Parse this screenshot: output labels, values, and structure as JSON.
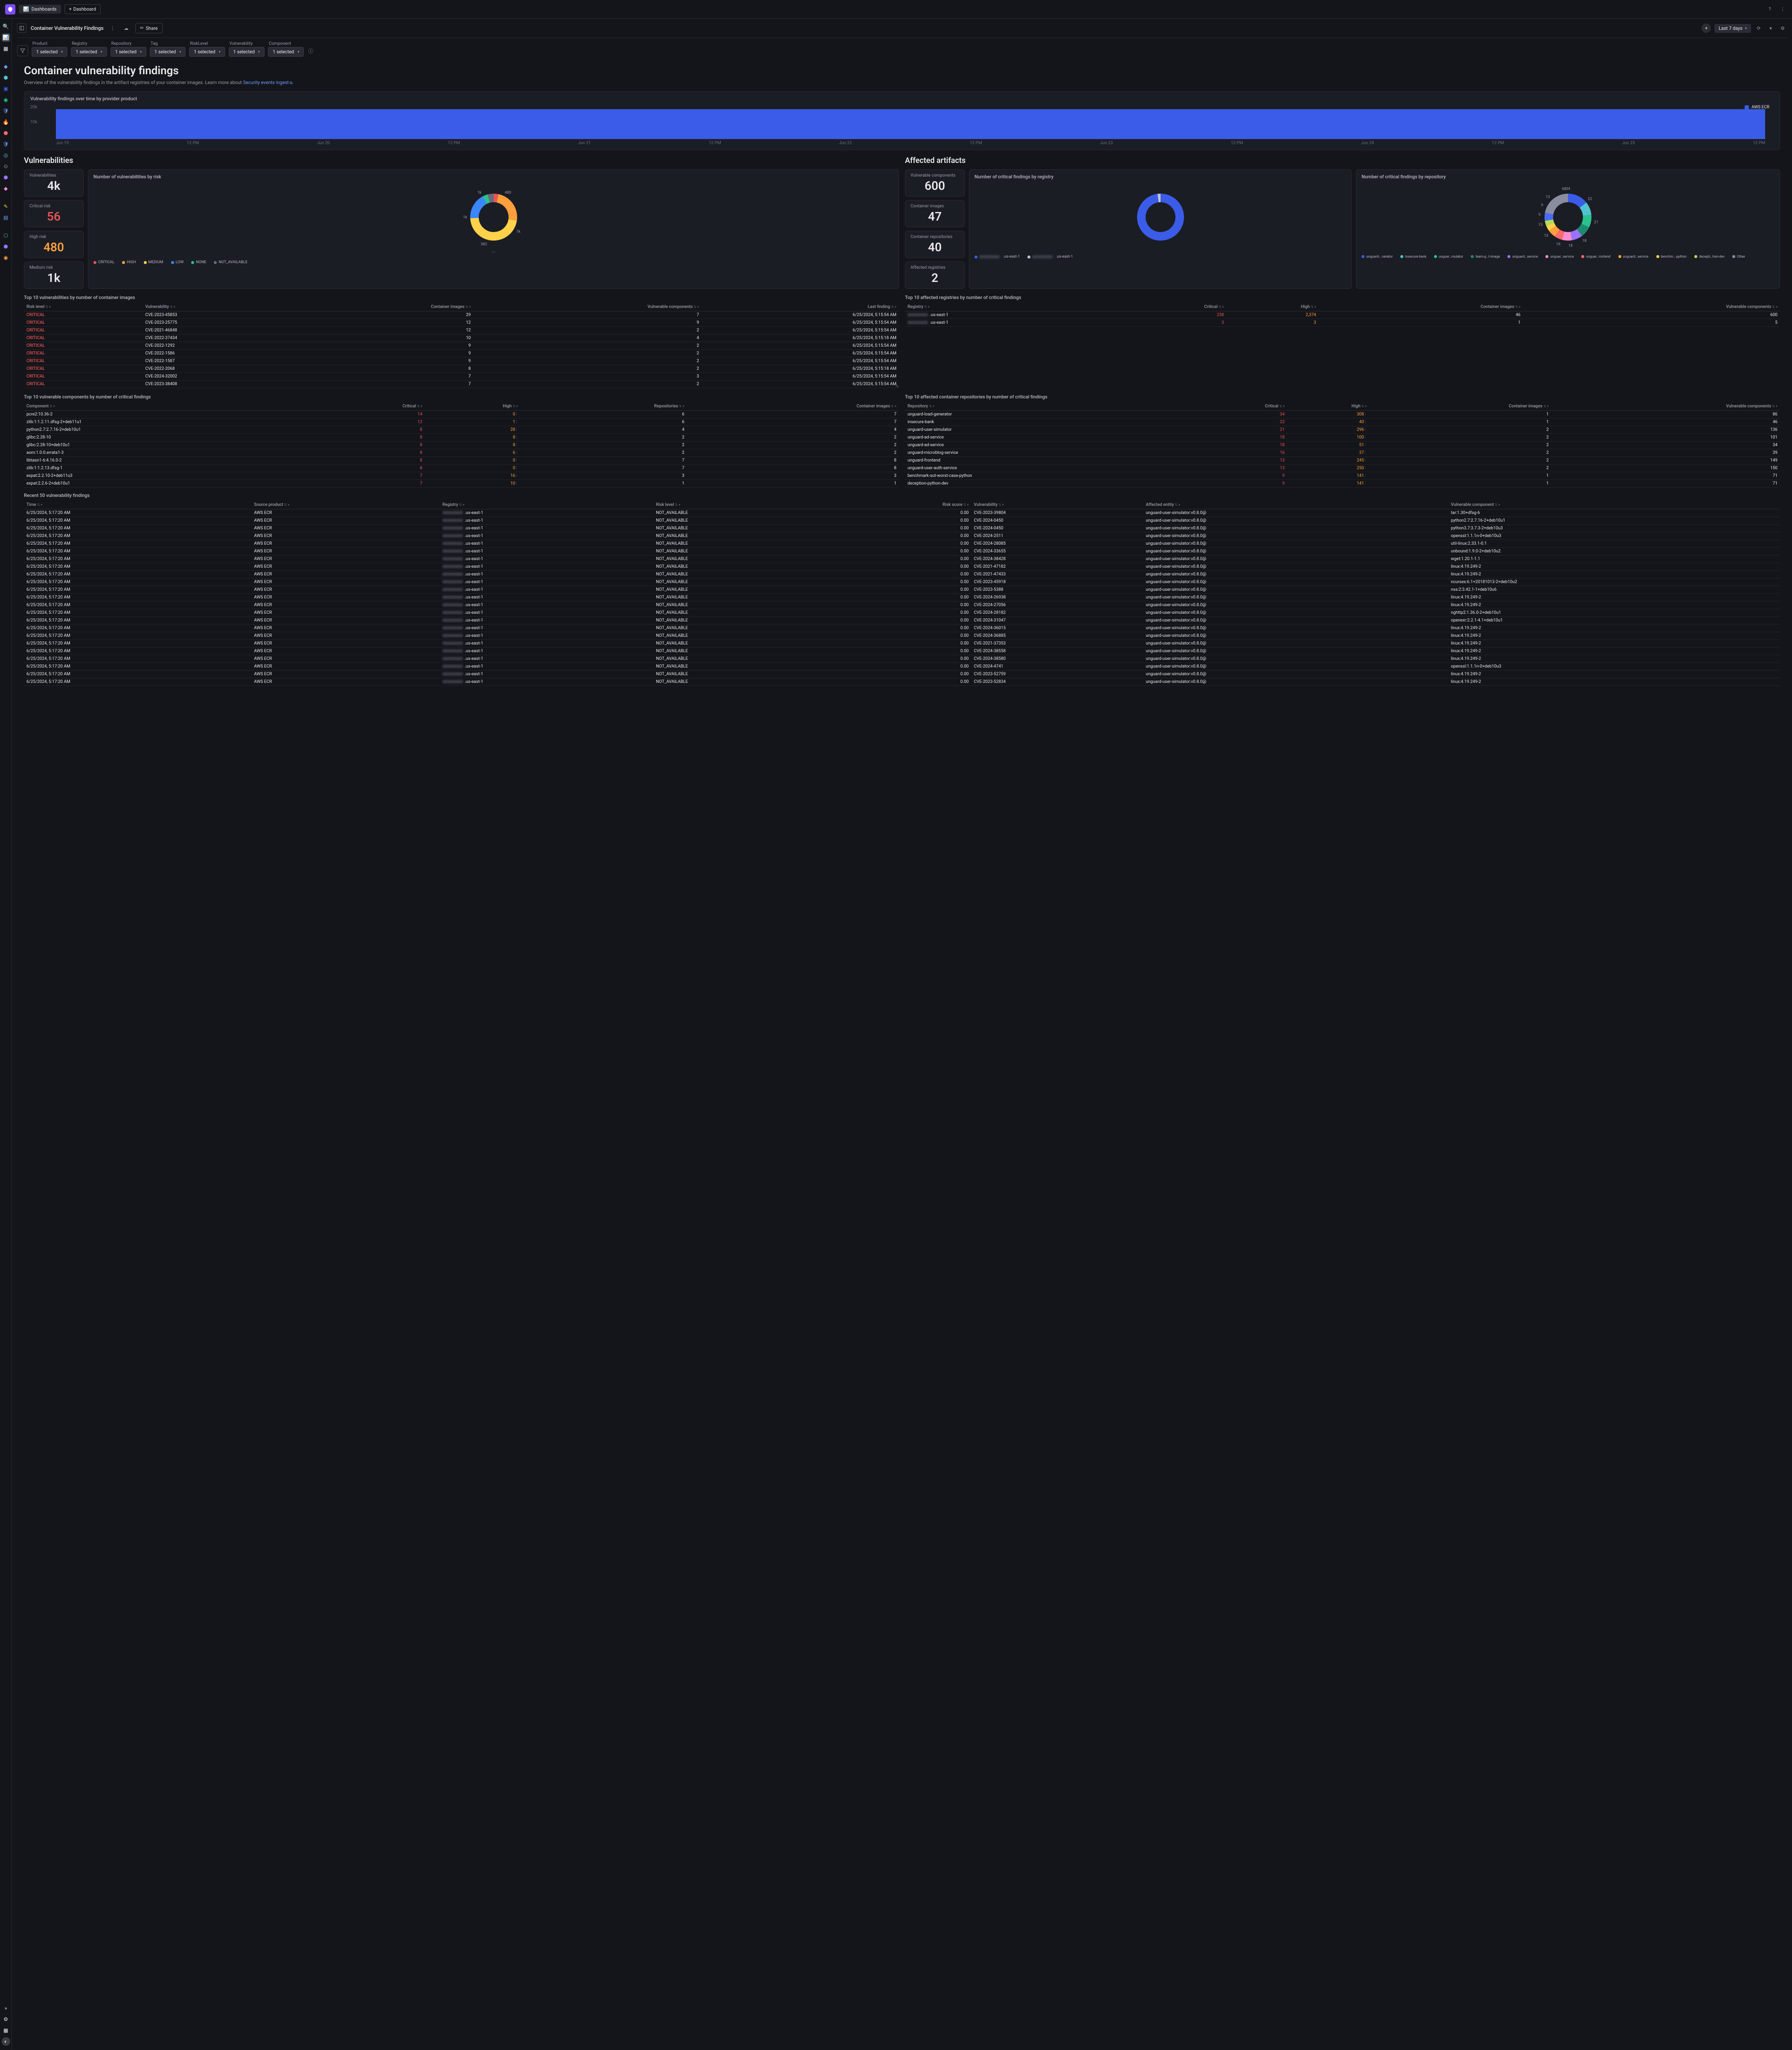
{
  "breadcrumb": {
    "dashboards": "Dashboards",
    "new_dashboard": "Dashboard"
  },
  "page": {
    "title": "Container Vulnerability Findings",
    "share": "Share",
    "timerange": "Last 7 days"
  },
  "filters": [
    {
      "label": "Product",
      "value": "1 selected"
    },
    {
      "label": "Registry",
      "value": "1 selected"
    },
    {
      "label": "Repository",
      "value": "1 selected"
    },
    {
      "label": "Tag",
      "value": "1 selected"
    },
    {
      "label": "RiskLevel",
      "value": "1 selected"
    },
    {
      "label": "Vulnerability",
      "value": "1 selected"
    },
    {
      "label": "Component",
      "value": "1 selected"
    }
  ],
  "heading": "Container vulnerability findings",
  "subtitle_prefix": "Overview of the vulnerability findings in the artifact registries of your container images. Learn more about ",
  "subtitle_link": "Security events ingest",
  "chart_time_title": "Vulnerability findings over time by provider product",
  "chart_time_legend": "AWS ECR",
  "chart_data": {
    "type": "bar",
    "title": "Vulnerability findings over time by provider product",
    "ylabel": "",
    "xlabel": "",
    "ylim": [
      0,
      20000
    ],
    "y_ticks": [
      "20k",
      "10k",
      ""
    ],
    "x_ticks": [
      "Jun 19",
      "12 PM",
      "Jun 20",
      "12 PM",
      "Jun 21",
      "12 PM",
      "Jun 22",
      "12 PM",
      "Jun 23",
      "12 PM",
      "Jun 24",
      "12 PM",
      "Jun 25",
      "12 PM"
    ],
    "series": [
      {
        "name": "AWS ECR",
        "color": "#3b5ce8",
        "values": [
          20000,
          20000,
          20000,
          20000,
          20000,
          20000,
          20000,
          20000,
          20000,
          20000,
          20000,
          20000,
          20000,
          20000
        ]
      }
    ]
  },
  "sections": {
    "vuln": "Vulnerabilities",
    "artifacts": "Affected artifacts"
  },
  "metrics_vuln": [
    {
      "label": "Vulnerabilities",
      "value": "4k"
    },
    {
      "label": "Critical risk",
      "value": "56",
      "cls": "red"
    },
    {
      "label": "High risk",
      "value": "480",
      "cls": "orange"
    },
    {
      "label": "Medium risk",
      "value": "1k"
    }
  ],
  "donut_risk": {
    "title": "Number of vulnerabilities by risk",
    "labels": [
      {
        "text": "480",
        "a": -60
      },
      {
        "text": "1k",
        "a": 30
      },
      {
        "text": "382",
        "a": 110
      },
      {
        "text": "1k",
        "a": 180
      },
      {
        "text": "1k",
        "a": 240
      }
    ],
    "segments": [
      {
        "c": "#e85454",
        "d": 16
      },
      {
        "c": "#ff9f3e",
        "d": 118
      },
      {
        "c": "#ffd24a",
        "d": 230
      },
      {
        "c": "#3a86ff",
        "d": 88
      },
      {
        "c": "#29c28e",
        "d": 18
      },
      {
        "c": "#6a6a78",
        "d": 20
      }
    ],
    "legend": [
      {
        "c": "#e85454",
        "t": "CRITICAL"
      },
      {
        "c": "#ff9f3e",
        "t": "HIGH"
      },
      {
        "c": "#ffd24a",
        "t": "MEDIUM"
      },
      {
        "c": "#3a86ff",
        "t": "LOW"
      },
      {
        "c": "#29c28e",
        "t": "NONE"
      },
      {
        "c": "#6a6a78",
        "t": "NOT_AVAILABLE"
      }
    ]
  },
  "metrics_art": [
    {
      "label": "Vulnerable components",
      "value": "600"
    },
    {
      "label": "Container images",
      "value": "47"
    },
    {
      "label": "Container repositories",
      "value": "40"
    },
    {
      "label": "Affected registries",
      "value": "2"
    }
  ],
  "donut_registry": {
    "title": "Number of critical findings by registry",
    "segments": [
      {
        "c": "#3b5ce8",
        "d": 480
      },
      {
        "c": "#c0c4d2",
        "d": 10
      }
    ],
    "legend": [
      {
        "c": "#3b5ce8",
        "t": ".us-east-1"
      },
      {
        "c": "#c0c4d2",
        "t": ".us-east-1"
      }
    ]
  },
  "donut_repo": {
    "title": "Number of critical findings by repository",
    "labels": [
      {
        "text": "34",
        "a": -90
      },
      {
        "text": "22",
        "a": -40
      },
      {
        "text": "21",
        "a": 10
      },
      {
        "text": "18",
        "a": 55
      },
      {
        "text": "18",
        "a": 85
      },
      {
        "text": "16",
        "a": 110
      },
      {
        "text": "13",
        "a": 140
      },
      {
        "text": "13",
        "a": 165
      },
      {
        "text": "9",
        "a": 185
      },
      {
        "text": "9",
        "a": 205
      },
      {
        "text": "13",
        "a": 225
      },
      {
        "text": "68",
        "a": 262
      }
    ],
    "segments": [
      {
        "c": "#3b5ce8",
        "d": 70
      },
      {
        "c": "#4fc4cf",
        "d": 45
      },
      {
        "c": "#29c28e",
        "d": 43
      },
      {
        "c": "#1b8d6e",
        "d": 37
      },
      {
        "c": "#9b72ff",
        "d": 37
      },
      {
        "c": "#ff8bd1",
        "d": 33
      },
      {
        "c": "#ff6b6b",
        "d": 27
      },
      {
        "c": "#ff9f3e",
        "d": 27
      },
      {
        "c": "#ffd24a",
        "d": 18
      },
      {
        "c": "#b5de54",
        "d": 18
      },
      {
        "c": "#4a6bff",
        "d": 27
      },
      {
        "c": "#8a8da0",
        "d": 108
      }
    ],
    "legend": [
      {
        "c": "#3b5ce8",
        "t": "unguard-…nerator"
      },
      {
        "c": "#4fc4cf",
        "t": "insecure-bank"
      },
      {
        "c": "#29c28e",
        "t": "unguar…mulator"
      },
      {
        "c": "#1b8d6e",
        "t": "team-g…t-image"
      },
      {
        "c": "#9b72ff",
        "t": "unguard…service"
      },
      {
        "c": "#ff8bd1",
        "t": "unguar…service"
      },
      {
        "c": "#ff6b6b",
        "t": "unguar…rontend"
      },
      {
        "c": "#ff9f3e",
        "t": "unguard…service"
      },
      {
        "c": "#ffd24a",
        "t": "benchm…-python"
      },
      {
        "c": "#b5de54",
        "t": "decepti…hon-dev"
      },
      {
        "c": "#8a8da0",
        "t": "Other"
      }
    ]
  },
  "table_top_vuln": {
    "title": "Top 10 vulnerabilities by number of container images",
    "cols": [
      "Risk level",
      "Vulnerability",
      "Container images",
      "Vulnerable components",
      "Last finding"
    ],
    "rows": [
      [
        "CRITICAL",
        "CVE-2023-45853",
        "29",
        "7",
        "6/25/2024, 5:15:54 AM"
      ],
      [
        "CRITICAL",
        "CVE-2023-25775",
        "12",
        "9",
        "6/25/2024, 5:15:54 AM"
      ],
      [
        "CRITICAL",
        "CVE-2021-46848",
        "12",
        "2",
        "6/25/2024, 5:15:54 AM"
      ],
      [
        "CRITICAL",
        "CVE-2022-37434",
        "10",
        "4",
        "6/25/2024, 5:15:18 AM"
      ],
      [
        "CRITICAL",
        "CVE-2022-1292",
        "9",
        "2",
        "6/25/2024, 5:15:54 AM"
      ],
      [
        "CRITICAL",
        "CVE-2022-1586",
        "9",
        "2",
        "6/25/2024, 5:15:54 AM"
      ],
      [
        "CRITICAL",
        "CVE-2022-1587",
        "9",
        "2",
        "6/25/2024, 5:15:54 AM"
      ],
      [
        "CRITICAL",
        "CVE-2022-2068",
        "8",
        "2",
        "6/25/2024, 5:15:18 AM"
      ],
      [
        "CRITICAL",
        "CVE-2024-32002",
        "7",
        "3",
        "6/25/2024, 5:15:54 AM"
      ],
      [
        "CRITICAL",
        "CVE-2023-38408",
        "7",
        "2",
        "6/25/2024, 5:15:54 AM"
      ]
    ]
  },
  "table_top_registries": {
    "title": "Top 10 affected registries by number of critical findings",
    "cols": [
      "Registry",
      "Critical",
      "High",
      "Container images",
      "Vulnerable components"
    ],
    "rows": [
      [
        ".us-east-1",
        "238",
        "2,374",
        "46",
        "600"
      ],
      [
        ".us-east-1",
        "3",
        "3",
        "1",
        "5"
      ]
    ]
  },
  "table_top_components": {
    "title": "Top 10 vulnerable components by number of critical findings",
    "cols": [
      "Component",
      "Critical",
      "High",
      "Repositories",
      "Container images"
    ],
    "rows": [
      [
        "pcre2:10.36-2",
        "14",
        "0",
        "6",
        "7"
      ],
      [
        "zlib:1:1.2.11.dfsg-2+deb11u1",
        "12",
        "1",
        "6",
        "7"
      ],
      [
        "python2.7:2.7.16-2+deb10u1",
        "8",
        "28",
        "4",
        "4"
      ],
      [
        "glibc:2.28-10",
        "8",
        "8",
        "2",
        "2"
      ],
      [
        "glibc:2.28-10+deb10u1",
        "8",
        "8",
        "2",
        "2"
      ],
      [
        "aom:1.0.0.errata1-3",
        "8",
        "6",
        "2",
        "2"
      ],
      [
        "libtasn1-6:4.16.0-2",
        "8",
        "0",
        "7",
        "8"
      ],
      [
        "zlib:1:1.2.13.dfsg-1",
        "8",
        "0",
        "7",
        "8"
      ],
      [
        "expat:2.2.10-2+deb11u3",
        "7",
        "16",
        "3",
        "3"
      ],
      [
        "expat:2.2.6-2+deb10u1",
        "7",
        "10",
        "1",
        "1"
      ]
    ]
  },
  "table_top_repos": {
    "title": "Top 10 affected container repositories by number of critical findings",
    "cols": [
      "Repository",
      "Critical",
      "High",
      "Container images",
      "Vulnerable components"
    ],
    "rows": [
      [
        "unguard-load-generator",
        "34",
        "308",
        "1",
        "86"
      ],
      [
        "insecure-bank",
        "22",
        "40",
        "1",
        "46"
      ],
      [
        "unguard-user-simulator",
        "21",
        "296",
        "2",
        "136"
      ],
      [
        "unguard-ad-service",
        "18",
        "100",
        "2",
        "101"
      ],
      [
        "unguard-ad-service",
        "18",
        "51",
        "2",
        "34"
      ],
      [
        "unguard-microblog-service",
        "16",
        "37",
        "2",
        "39"
      ],
      [
        "unguard-frontend",
        "13",
        "245",
        "2",
        "149"
      ],
      [
        "unguard-user-auth-service",
        "13",
        "250",
        "2",
        "150"
      ],
      [
        "benchmark-sut-worst-case-python",
        "9",
        "141",
        "1",
        "71"
      ],
      [
        "deception-python-dev",
        "9",
        "141",
        "1",
        "71"
      ]
    ]
  },
  "table_recent": {
    "title": "Recent 50 vulnerability findings",
    "cols": [
      "Time",
      "Source product",
      "Registry",
      "Risk level",
      "Risk score",
      "Vulnerability",
      "Affected entity",
      "Vulnerable component"
    ],
    "rows": [
      [
        "6/25/2024, 5:17:20 AM",
        "AWS ECR",
        ".us-east-1",
        "NOT_AVAILABLE",
        "0.00",
        "CVE-2023-39804",
        "unguard-user-simulator:v0.8.0@",
        "tar:1.30+dfsg-6"
      ],
      [
        "6/25/2024, 5:17:20 AM",
        "AWS ECR",
        ".us-east-1",
        "NOT_AVAILABLE",
        "0.00",
        "CVE-2024-0450",
        "unguard-user-simulator:v0.8.0@",
        "python2.7:2.7.16-2+deb10u1"
      ],
      [
        "6/25/2024, 5:17:20 AM",
        "AWS ECR",
        ".us-east-1",
        "NOT_AVAILABLE",
        "0.00",
        "CVE-2024-0450",
        "unguard-user-simulator:v0.8.0@",
        "python3.7:3.7.3-2+deb10u3"
      ],
      [
        "6/25/2024, 5:17:20 AM",
        "AWS ECR",
        ".us-east-1",
        "NOT_AVAILABLE",
        "0.00",
        "CVE-2024-2511",
        "unguard-user-simulator:v0.8.0@",
        "openssl:1.1.1n-0+deb10u3"
      ],
      [
        "6/25/2024, 5:17:20 AM",
        "AWS ECR",
        ".us-east-1",
        "NOT_AVAILABLE",
        "0.00",
        "CVE-2024-28085",
        "unguard-user-simulator:v0.8.0@",
        "util-linux:2.33.1-0.1"
      ],
      [
        "6/25/2024, 5:17:20 AM",
        "AWS ECR",
        ".us-east-1",
        "NOT_AVAILABLE",
        "0.00",
        "CVE-2024-33655",
        "unguard-user-simulator:v0.8.0@",
        "unbound:1.9.0-2+deb10u2"
      ],
      [
        "6/25/2024, 5:17:20 AM",
        "AWS ECR",
        ".us-east-1",
        "NOT_AVAILABLE",
        "0.00",
        "CVE-2024-38428",
        "unguard-user-simulator:v0.8.0@",
        "wget:1.20.1-1.1"
      ],
      [
        "6/25/2024, 5:17:20 AM",
        "AWS ECR",
        ".us-east-1",
        "NOT_AVAILABLE",
        "0.00",
        "CVE-2021-47182",
        "unguard-user-simulator:v0.8.0@",
        "linux:4.19.249-2"
      ],
      [
        "6/25/2024, 5:17:20 AM",
        "AWS ECR",
        ".us-east-1",
        "NOT_AVAILABLE",
        "0.00",
        "CVE-2021-47433",
        "unguard-user-simulator:v0.8.0@",
        "linux:4.19.249-2"
      ],
      [
        "6/25/2024, 5:17:20 AM",
        "AWS ECR",
        ".us-east-1",
        "NOT_AVAILABLE",
        "0.00",
        "CVE-2023-45918",
        "unguard-user-simulator:v0.8.0@",
        "ncurses:6.1+20181013-2+deb10u2"
      ],
      [
        "6/25/2024, 5:17:20 AM",
        "AWS ECR",
        ".us-east-1",
        "NOT_AVAILABLE",
        "0.00",
        "CVE-2023-5388",
        "unguard-user-simulator:v0.8.0@",
        "nss:2:3.42.1-1+deb10u6"
      ],
      [
        "6/25/2024, 5:17:20 AM",
        "AWS ECR",
        ".us-east-1",
        "NOT_AVAILABLE",
        "0.00",
        "CVE-2024-26938",
        "unguard-user-simulator:v0.8.0@",
        "linux:4.19.249-2"
      ],
      [
        "6/25/2024, 5:17:20 AM",
        "AWS ECR",
        ".us-east-1",
        "NOT_AVAILABLE",
        "0.00",
        "CVE-2024-27056",
        "unguard-user-simulator:v0.8.0@",
        "linux:4.19.249-2"
      ],
      [
        "6/25/2024, 5:17:20 AM",
        "AWS ECR",
        ".us-east-1",
        "NOT_AVAILABLE",
        "0.00",
        "CVE-2024-28182",
        "unguard-user-simulator:v0.8.0@",
        "nghttp2:1.36.0-2+deb10u1"
      ],
      [
        "6/25/2024, 5:17:20 AM",
        "AWS ECR",
        ".us-east-1",
        "NOT_AVAILABLE",
        "0.00",
        "CVE-2024-31047",
        "unguard-user-simulator:v0.8.0@",
        "openexr:2.2.1-4.1+deb10u1"
      ],
      [
        "6/25/2024, 5:17:20 AM",
        "AWS ECR",
        ".us-east-1",
        "NOT_AVAILABLE",
        "0.00",
        "CVE-2024-36015",
        "unguard-user-simulator:v0.8.0@",
        "linux:4.19.249-2"
      ],
      [
        "6/25/2024, 5:17:20 AM",
        "AWS ECR",
        ".us-east-1",
        "NOT_AVAILABLE",
        "0.00",
        "CVE-2024-36885",
        "unguard-user-simulator:v0.8.0@",
        "linux:4.19.249-2"
      ],
      [
        "6/25/2024, 5:17:20 AM",
        "AWS ECR",
        ".us-east-1",
        "NOT_AVAILABLE",
        "0.00",
        "CVE-2021-37353",
        "unguard-user-simulator:v0.8.0@",
        "linux:4.19.249-2"
      ],
      [
        "6/25/2024, 5:17:20 AM",
        "AWS ECR",
        ".us-east-1",
        "NOT_AVAILABLE",
        "0.00",
        "CVE-2024-38558",
        "unguard-user-simulator:v0.8.0@",
        "linux:4.19.249-2"
      ],
      [
        "6/25/2024, 5:17:20 AM",
        "AWS ECR",
        ".us-east-1",
        "NOT_AVAILABLE",
        "0.00",
        "CVE-2024-38580",
        "unguard-user-simulator:v0.8.0@",
        "linux:4.19.249-2"
      ],
      [
        "6/25/2024, 5:17:20 AM",
        "AWS ECR",
        ".us-east-1",
        "NOT_AVAILABLE",
        "0.00",
        "CVE-2024-4741",
        "unguard-user-simulator:v0.8.0@",
        "openssl:1.1.1n-0+deb10u3"
      ],
      [
        "6/25/2024, 5:17:20 AM",
        "AWS ECR",
        ".us-east-1",
        "NOT_AVAILABLE",
        "0.00",
        "CVE-2023-52759",
        "unguard-user-simulator:v0.8.0@",
        "linux:4.19.249-2"
      ],
      [
        "6/25/2024, 5:17:20 AM",
        "AWS ECR",
        ".us-east-1",
        "NOT_AVAILABLE",
        "0.00",
        "CVE-2023-52834",
        "unguard-user-simulator:v0.8.0@",
        "linux:4.19.249-2"
      ]
    ]
  }
}
